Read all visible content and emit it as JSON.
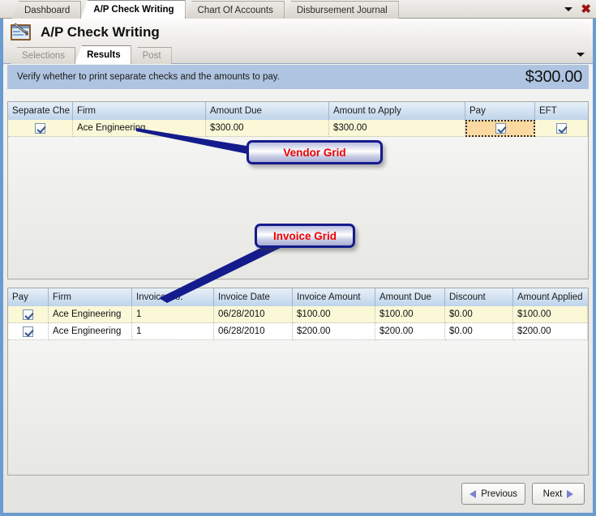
{
  "window": {
    "doc_tabs": [
      {
        "label": "Dashboard",
        "active": false
      },
      {
        "label": "A/P Check Writing",
        "active": true
      },
      {
        "label": "Chart Of Accounts",
        "active": false
      },
      {
        "label": "Disbursement Journal",
        "active": false
      }
    ],
    "dropdown_icon": "chevron-down-icon",
    "close_icon": "close-icon",
    "title": "A/P Check Writing",
    "app_icon": "check-writing-icon"
  },
  "wizard": {
    "tabs": [
      {
        "label": "Selections",
        "active": false,
        "disabled": true
      },
      {
        "label": "Results",
        "active": true,
        "disabled": false
      },
      {
        "label": "Post",
        "active": false,
        "disabled": true
      }
    ],
    "overflow_icon": "chevron-down-icon"
  },
  "banner": {
    "text": "Verify whether to print separate checks and the amounts to pay.",
    "amount": "$300.00",
    "background": "#afc4e0"
  },
  "vendor_grid": {
    "columns": [
      "Separate Che",
      "Firm",
      "Amount Due",
      "Amount to Apply",
      "Pay",
      "EFT"
    ],
    "rows": [
      {
        "separate_check": true,
        "firm": "Ace Engineering",
        "amount_due": "$300.00",
        "amount_to_apply": "$300.00",
        "pay": true,
        "eft": true
      }
    ]
  },
  "invoice_grid": {
    "columns": [
      "Pay",
      "Firm",
      "Invoice No.",
      "Invoice Date",
      "Invoice Amount",
      "Amount Due",
      "Discount",
      "Amount Applied"
    ],
    "rows": [
      {
        "pay": true,
        "firm": "Ace Engineering",
        "invoice_no": "1",
        "invoice_date": "06/28/2010",
        "invoice_amount": "$100.00",
        "amount_due": "$100.00",
        "discount": "$0.00",
        "amount_applied": "$100.00"
      },
      {
        "pay": true,
        "firm": "Ace Engineering",
        "invoice_no": "1",
        "invoice_date": "06/28/2010",
        "invoice_amount": "$200.00",
        "amount_due": "$200.00",
        "discount": "$0.00",
        "amount_applied": "$200.00"
      }
    ]
  },
  "callouts": {
    "vendor": "Vendor Grid",
    "invoice": "Invoice Grid",
    "border_color": "#141b8c",
    "text_color": "#ee0000"
  },
  "footer": {
    "previous_label": "Previous",
    "next_label": "Next",
    "previous_icon": "triangle-left-icon",
    "next_icon": "triangle-right-icon"
  }
}
